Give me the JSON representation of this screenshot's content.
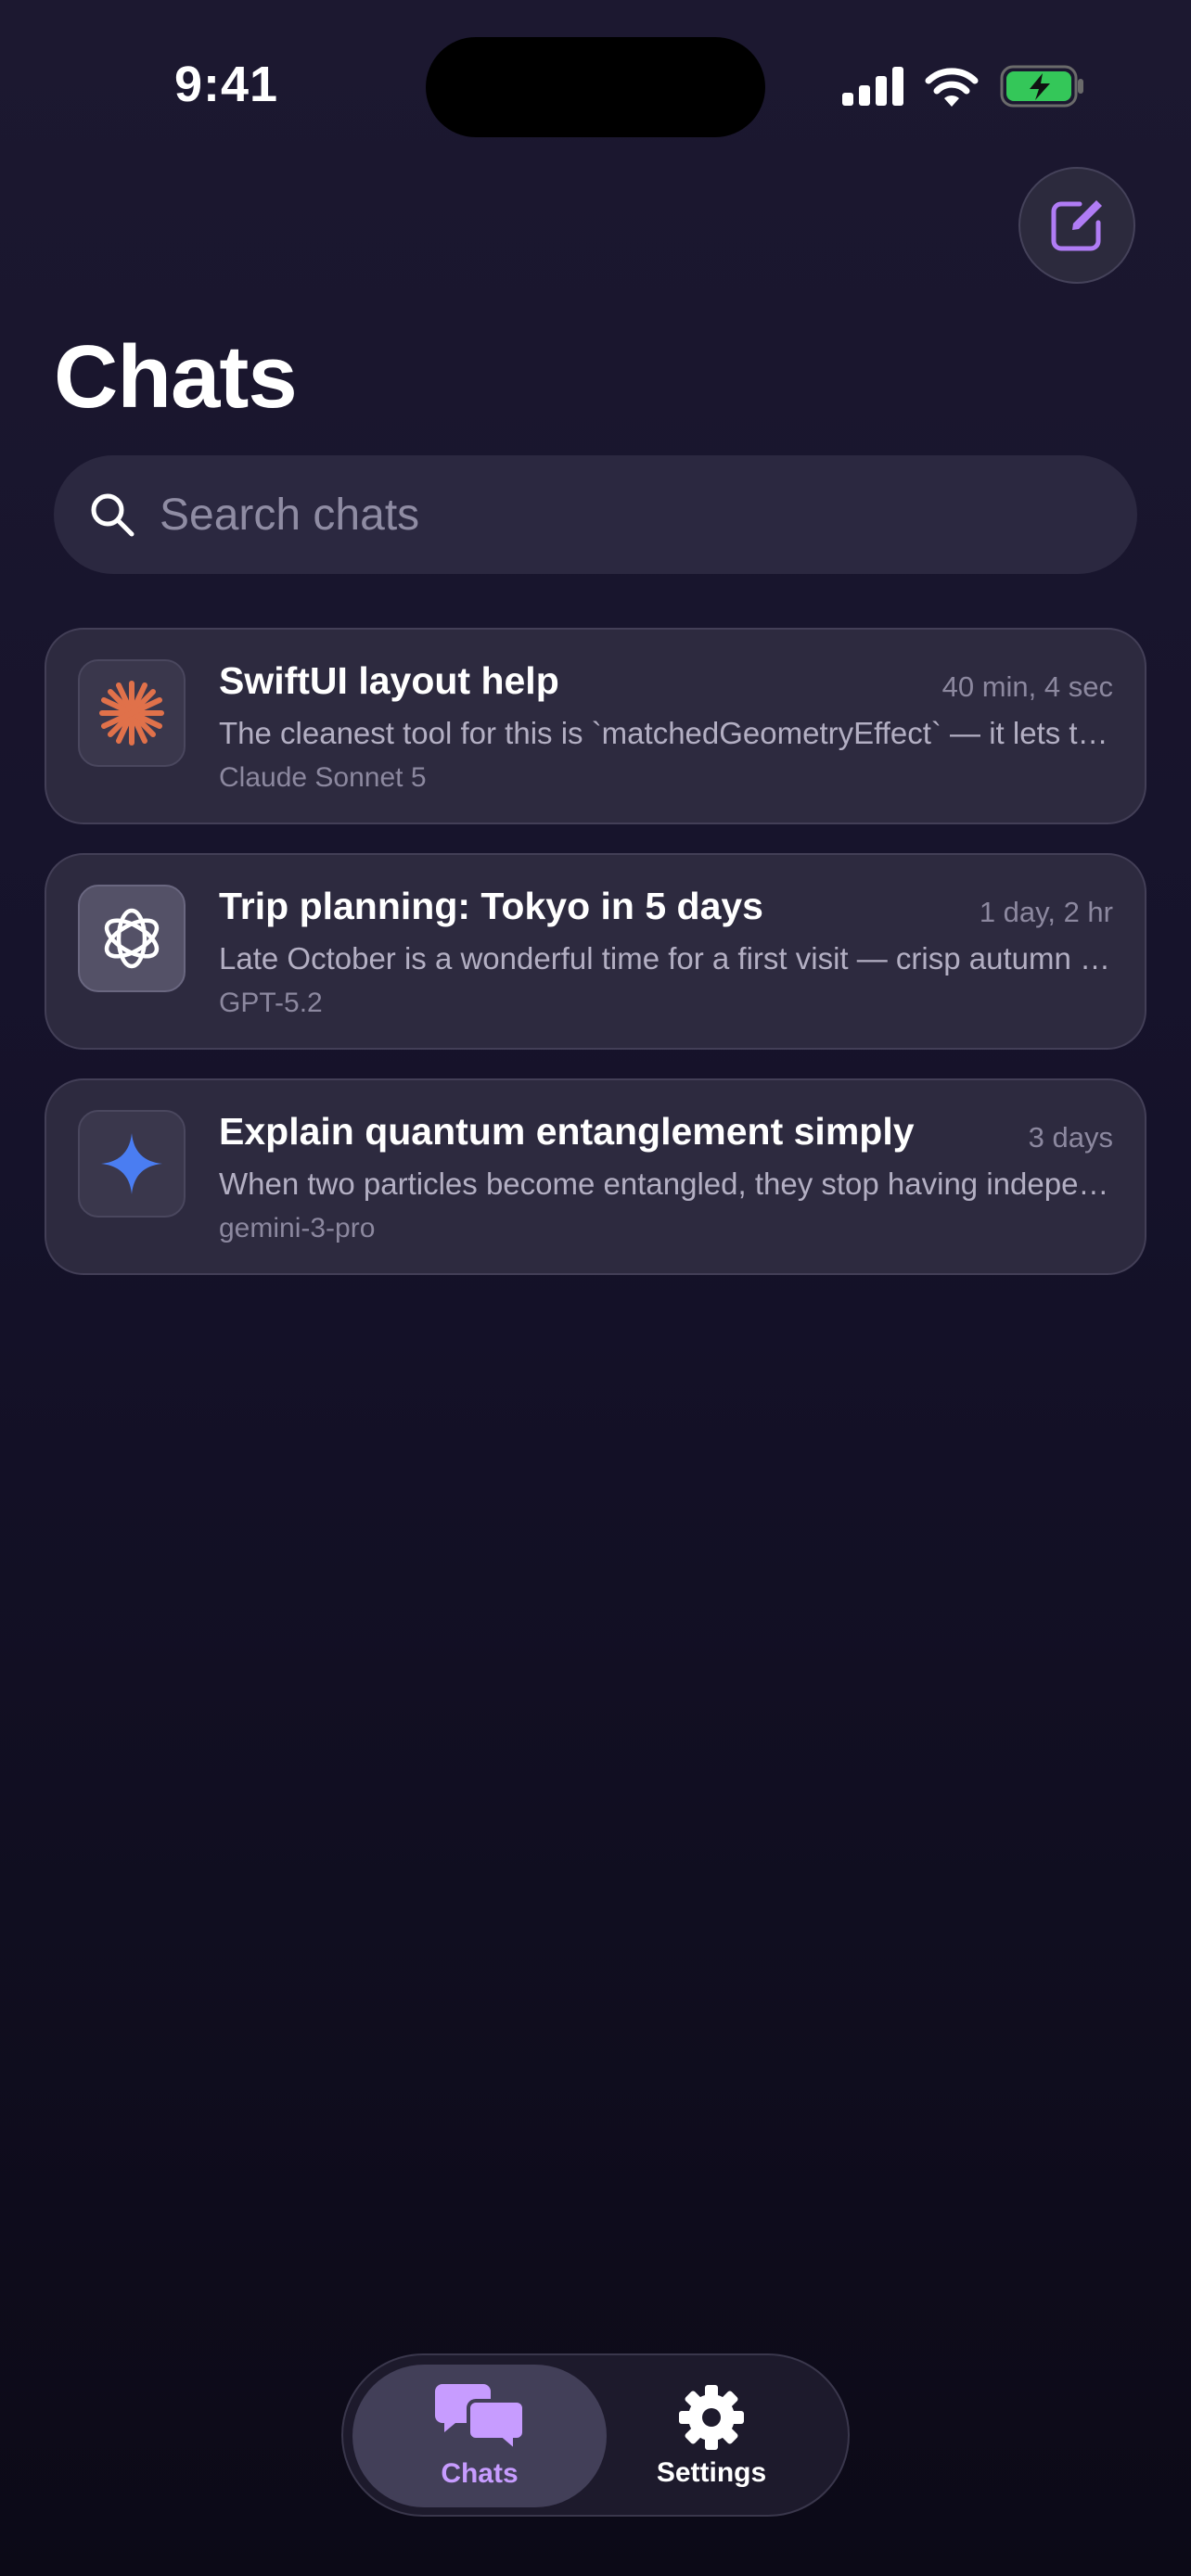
{
  "status_bar": {
    "time": "9:41",
    "icons": [
      "cellular-signal-icon",
      "wifi-icon",
      "battery-charging-icon"
    ],
    "battery_color": "#34c759"
  },
  "header": {
    "compose_icon": "compose-icon",
    "title": "Chats"
  },
  "search": {
    "placeholder": "Search chats",
    "value": "",
    "icon": "search-icon"
  },
  "chats": [
    {
      "title": "SwiftUI layout help",
      "time": "40 min, 4 sec",
      "preview": "The cleanest tool for this is `matchedGeometryEffect` — it lets two views share an animation.",
      "model": "Claude Sonnet 5",
      "icon": "claude-logo-icon",
      "icon_color": "#e0714a"
    },
    {
      "title": "Trip planning: Tokyo in 5 days",
      "time": "1 day, 2 hr",
      "preview": "Late October is a wonderful time for a first visit — crisp autumn weather and fewer crowds.",
      "model": "GPT-5.2",
      "icon": "openai-logo-icon",
      "icon_color": "#ffffff"
    },
    {
      "title": "Explain quantum entanglement simply",
      "time": "3 days",
      "preview": "When two particles become entangled, they stop having independent states of their own.",
      "model": "gemini-3-pro",
      "icon": "gemini-logo-icon",
      "icon_color": "#4a7df2"
    }
  ],
  "tab_bar": {
    "tabs": [
      {
        "label": "Chats",
        "icon": "chat-bubbles-icon",
        "active": true
      },
      {
        "label": "Settings",
        "icon": "gear-icon",
        "active": false
      }
    ],
    "accent_color": "#c79cff"
  }
}
